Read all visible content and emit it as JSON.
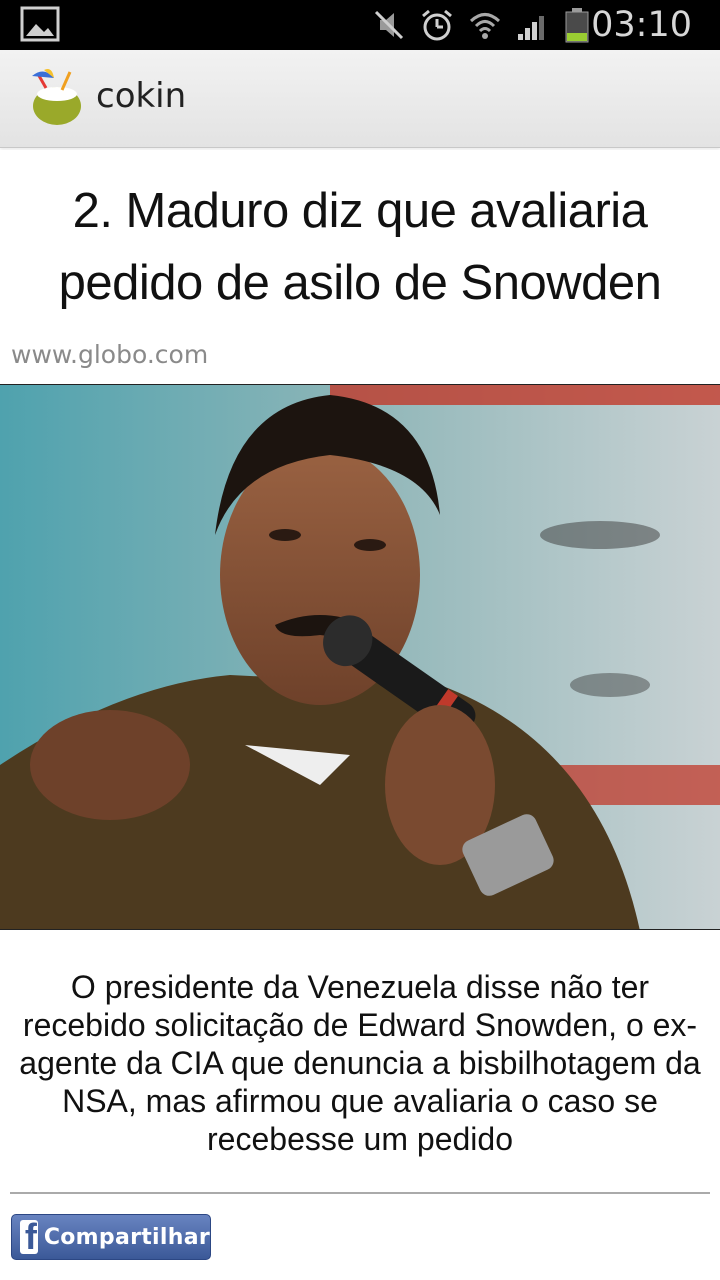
{
  "status_bar": {
    "time": "03:10",
    "icons": [
      "picture-icon",
      "mute-icon",
      "alarm-icon",
      "wifi-icon",
      "signal-icon",
      "battery-icon"
    ]
  },
  "app": {
    "title": "cokin",
    "logo_icon": "coconut-drink-icon"
  },
  "article": {
    "headline": "2. Maduro diz que avaliaria pedido de asilo de Snowden",
    "source": "www.globo.com",
    "summary": "O presidente da Venezuela disse não ter recebido solicitação de Edward Snowden, o ex-agente da CIA que denuncia a bisbilhotagem da NSA, mas afirmou que avaliaria o caso se recebesse um pedido"
  },
  "share": {
    "label": "Compartilhar",
    "fb_glyph": "f",
    "icon": "facebook-icon",
    "color": "#3b5998"
  },
  "colors": {
    "status_bar_bg": "#000000",
    "action_bar_bg": "#eeeeee",
    "battery_level": "#9acd32"
  }
}
